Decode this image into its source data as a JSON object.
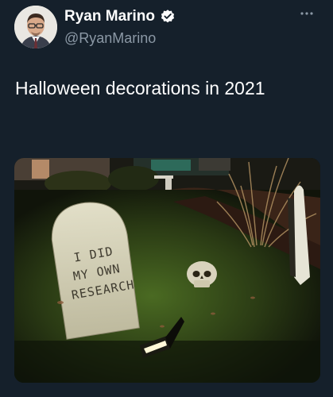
{
  "author": {
    "display_name": "Ryan Marino",
    "handle": "@RyanMarino",
    "verified": true
  },
  "tweet": {
    "text": "Halloween decorations in 2021"
  },
  "media": {
    "tombstone_lines": [
      "I DID",
      "MY OWN",
      "RESEARCH"
    ]
  },
  "icons": {
    "verified": "verified-badge-icon",
    "more": "more-dots-icon"
  },
  "colors": {
    "background": "#15202b",
    "secondary_text": "#8b98a5"
  }
}
